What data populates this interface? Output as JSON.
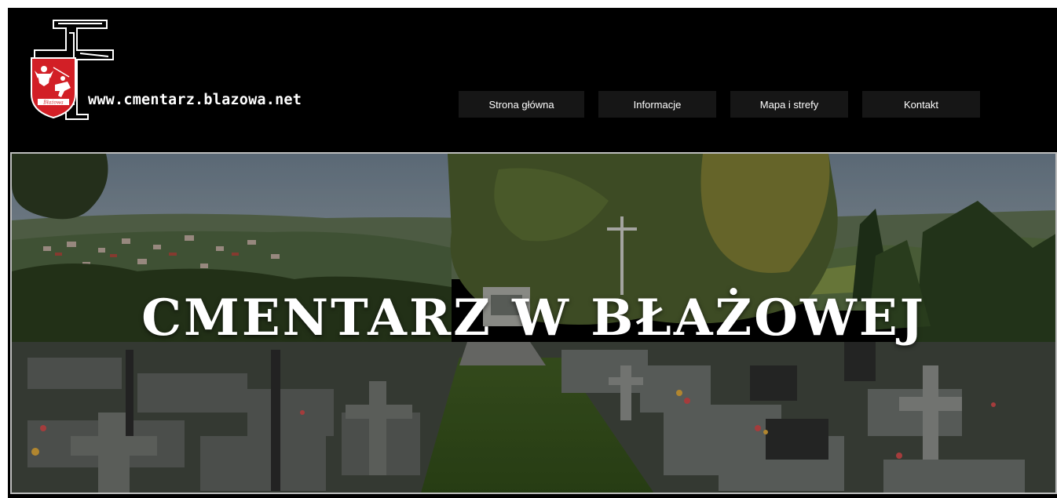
{
  "header": {
    "site_url": "www.cmentarz.blazowa.net",
    "logo": {
      "icon": "blazowa-coat-of-arms-with-cross",
      "shield_text": "Błażowa"
    }
  },
  "nav": {
    "items": [
      {
        "label": "Strona główna"
      },
      {
        "label": "Informacje"
      },
      {
        "label": "Mapa i strefy"
      },
      {
        "label": "Kontakt"
      }
    ]
  },
  "hero": {
    "title": "CMENTARZ W BŁAŻOWEJ",
    "image": "cemetery-panorama-photo"
  },
  "colors": {
    "background": "#000000",
    "nav_button": "#161616",
    "text": "#ffffff",
    "shield_red": "#d21f26"
  }
}
